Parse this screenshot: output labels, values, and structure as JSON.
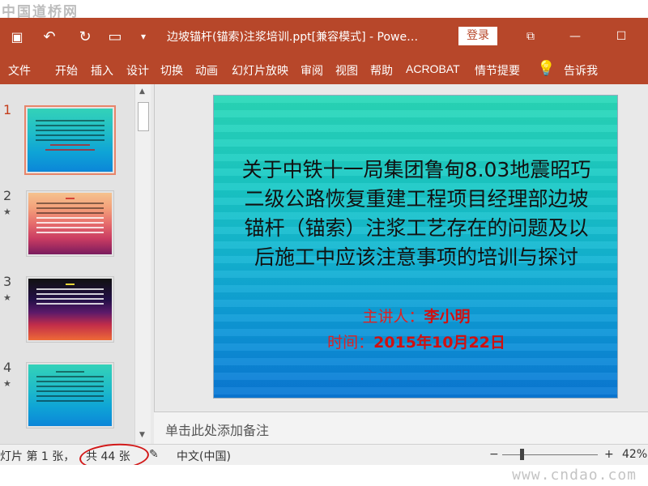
{
  "watermark": {
    "top": "中国道桥网",
    "bottom": "www.cndao.com"
  },
  "titlebar": {
    "icons": [
      "save-icon",
      "undo-icon",
      "redo-icon",
      "present-icon",
      "customize-icon"
    ],
    "glyphs": {
      "save": "▣",
      "undo": "↶",
      "redo": "↻",
      "present": "▭",
      "customize": "▾",
      "restore": "⧉",
      "minimize": "—",
      "maximize": "☐"
    },
    "title": "边坡锚杆(锚索)注浆培训.ppt[兼容模式]  -  Powe…",
    "login_label": "登录"
  },
  "ribbon": {
    "tabs": [
      "文件",
      "开始",
      "插入",
      "设计",
      "切换",
      "动画",
      "幻灯片放映",
      "审阅",
      "视图",
      "帮助",
      "ACROBAT",
      "情节提要",
      "告诉我"
    ],
    "lightbulb": "💡"
  },
  "thumbnails": {
    "items": [
      {
        "number": "1",
        "star": ""
      },
      {
        "number": "2",
        "star": "★"
      },
      {
        "number": "3",
        "star": "★"
      },
      {
        "number": "4",
        "star": "★"
      }
    ],
    "scroll_up": "▲",
    "scroll_down": "▼"
  },
  "slide": {
    "title": "关于中铁十一局集团鲁甸8.03地震昭巧二级公路恢复重建工程项目经理部边坡锚杆（锚索）注浆工艺存在的问题及以后施工中应该注意事项的培训与探讨",
    "presenter_label": "主讲人：",
    "presenter_value": "李小明",
    "date_label": "时间：",
    "date_value": "2015年10月22日"
  },
  "notes": {
    "placeholder": "单击此处添加备注"
  },
  "status": {
    "slide_prefix": "幻灯片 第 1 张，",
    "slide_total": "共 44 张",
    "notes_icon": "✎",
    "language": "中文(中国)",
    "zoom_minus": "−",
    "zoom_plus": "+",
    "zoom": "42%"
  },
  "colors": {
    "accent": "#b7472a",
    "highlight_ellipse": "#d21818",
    "slide_text_red": "#e02020"
  }
}
